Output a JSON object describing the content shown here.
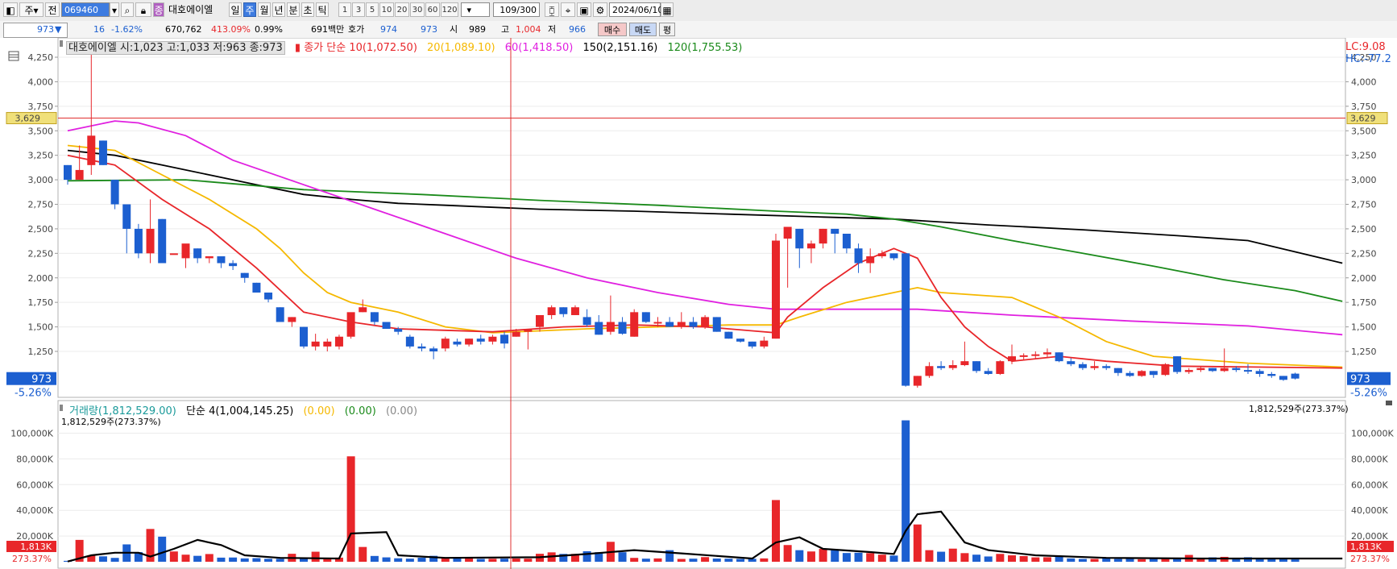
{
  "toolbar": {
    "tab_label": "주",
    "prefix_label": "전",
    "code_value": "069460",
    "search_icon": "search-icon",
    "stock_name": "대호에이엘",
    "periods": [
      "일",
      "주",
      "월",
      "년",
      "분",
      "초",
      "틱"
    ],
    "selected_period": "주",
    "minute_options": [
      "1",
      "3",
      "5",
      "10",
      "20",
      "30",
      "60",
      "120"
    ],
    "count_value": "109/300",
    "date_value": "2024/06/10"
  },
  "quote": {
    "price": "973",
    "change": "16",
    "change_pct": "-1.62%",
    "volume": "670,762",
    "volume_pct": "413.09%",
    "rate": "0.99%",
    "amount": "691백만",
    "bid_label": "호가",
    "bid": "974",
    "ask": "973",
    "open_label": "시",
    "open": "989",
    "high_label": "고",
    "high": "1,004",
    "low_label": "저",
    "low": "966",
    "buy_label": "매수",
    "sell_label": "매도",
    "flat_label": "평"
  },
  "price_legend": {
    "title": "대호에이엘 시:1,023 고:1,033 저:963 종:973",
    "ma_prefix": "종가 단순",
    "ma10": "10(1,072.50)",
    "ma20": "20(1,089.10)",
    "ma60": "60(1,418.50)",
    "ma150": "150(2,151.16)",
    "ma120": "120(1,755.53)",
    "lc": "LC:9.08",
    "hc": "HC:-77.2"
  },
  "price_axis": {
    "ticks": [
      "4,250",
      "4,000",
      "3,750",
      "3,500",
      "3,250",
      "3,000",
      "2,750",
      "2,500",
      "2,250",
      "2,000",
      "1,750",
      "1,500",
      "1,250"
    ],
    "marker_price": "3,629",
    "current_price": "973",
    "current_pct": "-5.26%"
  },
  "volume_legend": {
    "title": "거래량(1,812,529.00)",
    "ma_label": "단순 4(1,004,145.25)",
    "zero1": "(0.00)",
    "zero2": "(0.00)",
    "zero3": "(0.00)",
    "sub_left": "1,812,529주(273.37%)",
    "sub_right": "1,812,529주(273.37%)"
  },
  "volume_axis": {
    "ticks": [
      "100,000K",
      "80,000K",
      "60,000K",
      "40,000K",
      "20,000K"
    ],
    "current": "1,813K",
    "current_pct": "273.37%"
  },
  "colors": {
    "up": "#e8262a",
    "down": "#1c5fd0",
    "ma10": "#e8262a",
    "ma20": "#f5b800",
    "ma60": "#e020e0",
    "ma150": "#000000",
    "ma120": "#1a8a1a",
    "hline": "#e03030",
    "vline": "#e03030"
  },
  "chart_data": {
    "type": "candlestick",
    "period": "weekly",
    "marker_price": 3629,
    "candles": [
      [
        3150,
        3150,
        2950,
        3000
      ],
      [
        3000,
        3350,
        3000,
        3100
      ],
      [
        3150,
        4400,
        3050,
        3450
      ],
      [
        3400,
        3400,
        3150,
        3150
      ],
      [
        3000,
        3000,
        2700,
        2750
      ],
      [
        2750,
        2750,
        2250,
        2500
      ],
      [
        2500,
        2550,
        2200,
        2250
      ],
      [
        2250,
        2800,
        2150,
        2500
      ],
      [
        2600,
        2600,
        2150,
        2150
      ],
      [
        2250,
        2250,
        2250,
        2250
      ],
      [
        2200,
        2320,
        2100,
        2350
      ],
      [
        2300,
        2300,
        2150,
        2200
      ],
      [
        2200,
        2200,
        2150,
        2220
      ],
      [
        2220,
        2220,
        2100,
        2150
      ],
      [
        2150,
        2180,
        2080,
        2120
      ],
      [
        2050,
        2050,
        1950,
        2000
      ],
      [
        1950,
        1950,
        1850,
        1850
      ],
      [
        1850,
        1850,
        1750,
        1780
      ],
      [
        1700,
        1700,
        1550,
        1550
      ],
      [
        1550,
        1600,
        1500,
        1600
      ],
      [
        1500,
        1500,
        1280,
        1300
      ],
      [
        1300,
        1430,
        1260,
        1350
      ],
      [
        1300,
        1380,
        1250,
        1350
      ],
      [
        1300,
        1420,
        1270,
        1400
      ],
      [
        1400,
        1600,
        1380,
        1650
      ],
      [
        1650,
        1780,
        1650,
        1700
      ],
      [
        1650,
        1650,
        1520,
        1550
      ],
      [
        1550,
        1550,
        1480,
        1480
      ],
      [
        1480,
        1500,
        1420,
        1450
      ],
      [
        1400,
        1420,
        1280,
        1300
      ],
      [
        1300,
        1330,
        1250,
        1280
      ],
      [
        1280,
        1300,
        1170,
        1250
      ],
      [
        1280,
        1400,
        1250,
        1380
      ],
      [
        1350,
        1380,
        1300,
        1320
      ],
      [
        1320,
        1380,
        1300,
        1380
      ],
      [
        1380,
        1420,
        1320,
        1350
      ],
      [
        1350,
        1420,
        1320,
        1400
      ],
      [
        1420,
        1450,
        1280,
        1330
      ],
      [
        1400,
        1480,
        1400,
        1450
      ],
      [
        1450,
        1450,
        1270,
        1480
      ],
      [
        1500,
        1530,
        1450,
        1620
      ],
      [
        1620,
        1720,
        1580,
        1700
      ],
      [
        1700,
        1700,
        1600,
        1630
      ],
      [
        1620,
        1720,
        1620,
        1700
      ],
      [
        1600,
        1680,
        1500,
        1520
      ],
      [
        1550,
        1620,
        1420,
        1420
      ],
      [
        1450,
        1820,
        1420,
        1550
      ],
      [
        1550,
        1600,
        1420,
        1430
      ],
      [
        1400,
        1680,
        1400,
        1650
      ],
      [
        1650,
        1650,
        1540,
        1550
      ],
      [
        1550,
        1600,
        1500,
        1550
      ],
      [
        1550,
        1600,
        1500,
        1500
      ],
      [
        1500,
        1650,
        1480,
        1550
      ],
      [
        1550,
        1600,
        1480,
        1500
      ],
      [
        1500,
        1620,
        1480,
        1600
      ],
      [
        1600,
        1600,
        1450,
        1450
      ],
      [
        1450,
        1450,
        1380,
        1380
      ],
      [
        1380,
        1380,
        1340,
        1350
      ],
      [
        1350,
        1350,
        1280,
        1300
      ],
      [
        1300,
        1400,
        1280,
        1360
      ],
      [
        1380,
        2450,
        1380,
        2380
      ],
      [
        2400,
        2520,
        1900,
        2520
      ],
      [
        2500,
        2500,
        2100,
        2300
      ],
      [
        2300,
        2380,
        2150,
        2350
      ],
      [
        2350,
        2500,
        2300,
        2500
      ],
      [
        2500,
        2500,
        2250,
        2450
      ],
      [
        2450,
        2450,
        2250,
        2300
      ],
      [
        2300,
        2350,
        2050,
        2150
      ],
      [
        2150,
        2300,
        2050,
        2220
      ],
      [
        2220,
        2280,
        2200,
        2250
      ],
      [
        2250,
        2250,
        2180,
        2200
      ],
      [
        2250,
        2250,
        890,
        900
      ],
      [
        900,
        1000,
        880,
        1000
      ],
      [
        1000,
        1140,
        980,
        1100
      ],
      [
        1100,
        1150,
        1060,
        1080
      ],
      [
        1080,
        1160,
        1060,
        1110
      ],
      [
        1110,
        1350,
        1100,
        1150
      ],
      [
        1150,
        1150,
        1030,
        1050
      ],
      [
        1050,
        1080,
        1010,
        1020
      ],
      [
        1020,
        1160,
        1010,
        1150
      ],
      [
        1150,
        1320,
        1120,
        1200
      ],
      [
        1200,
        1230,
        1160,
        1210
      ],
      [
        1210,
        1250,
        1180,
        1220
      ],
      [
        1220,
        1280,
        1180,
        1240
      ],
      [
        1240,
        1240,
        1140,
        1150
      ],
      [
        1150,
        1180,
        1100,
        1120
      ],
      [
        1120,
        1140,
        1060,
        1080
      ],
      [
        1080,
        1150,
        1060,
        1100
      ],
      [
        1100,
        1120,
        1060,
        1080
      ],
      [
        1080,
        1080,
        1000,
        1030
      ],
      [
        1030,
        1050,
        990,
        1000
      ],
      [
        1000,
        1060,
        990,
        1050
      ],
      [
        1050,
        1050,
        980,
        1010
      ],
      [
        1010,
        1130,
        1000,
        1120
      ],
      [
        1200,
        1200,
        1020,
        1040
      ],
      [
        1040,
        1080,
        1020,
        1060
      ],
      [
        1060,
        1100,
        1040,
        1080
      ],
      [
        1080,
        1080,
        1040,
        1050
      ],
      [
        1050,
        1280,
        1040,
        1080
      ],
      [
        1080,
        1100,
        1040,
        1060
      ],
      [
        1060,
        1120,
        1020,
        1050
      ],
      [
        1050,
        1070,
        990,
        1020
      ],
      [
        1020,
        1040,
        980,
        1000
      ],
      [
        1000,
        1000,
        950,
        960
      ],
      [
        1023,
        1033,
        963,
        973
      ]
    ],
    "ma10": [
      [
        0,
        3250
      ],
      [
        4,
        3150
      ],
      [
        8,
        2800
      ],
      [
        12,
        2500
      ],
      [
        16,
        2100
      ],
      [
        20,
        1650
      ],
      [
        24,
        1550
      ],
      [
        28,
        1480
      ],
      [
        36,
        1450
      ],
      [
        42,
        1500
      ],
      [
        48,
        1520
      ],
      [
        54,
        1500
      ],
      [
        58,
        1460
      ],
      [
        60,
        1440
      ],
      [
        61,
        1600
      ],
      [
        64,
        1900
      ],
      [
        67,
        2150
      ],
      [
        70,
        2300
      ],
      [
        72,
        2200
      ],
      [
        74,
        1800
      ],
      [
        76,
        1500
      ],
      [
        78,
        1300
      ],
      [
        80,
        1150
      ],
      [
        84,
        1200
      ],
      [
        88,
        1150
      ],
      [
        94,
        1100
      ],
      [
        108,
        1080
      ]
    ],
    "ma20": [
      [
        0,
        3350
      ],
      [
        4,
        3300
      ],
      [
        8,
        3050
      ],
      [
        12,
        2800
      ],
      [
        16,
        2500
      ],
      [
        18,
        2300
      ],
      [
        20,
        2050
      ],
      [
        22,
        1850
      ],
      [
        24,
        1750
      ],
      [
        28,
        1650
      ],
      [
        32,
        1500
      ],
      [
        36,
        1440
      ],
      [
        40,
        1460
      ],
      [
        44,
        1480
      ],
      [
        50,
        1500
      ],
      [
        56,
        1520
      ],
      [
        60,
        1520
      ],
      [
        62,
        1600
      ],
      [
        66,
        1750
      ],
      [
        70,
        1850
      ],
      [
        72,
        1900
      ],
      [
        74,
        1850
      ],
      [
        80,
        1800
      ],
      [
        84,
        1600
      ],
      [
        88,
        1350
      ],
      [
        92,
        1200
      ],
      [
        100,
        1130
      ],
      [
        108,
        1090
      ]
    ],
    "ma60": [
      [
        0,
        3500
      ],
      [
        4,
        3600
      ],
      [
        6,
        3580
      ],
      [
        10,
        3450
      ],
      [
        14,
        3200
      ],
      [
        20,
        2950
      ],
      [
        26,
        2700
      ],
      [
        32,
        2450
      ],
      [
        38,
        2200
      ],
      [
        44,
        2000
      ],
      [
        50,
        1850
      ],
      [
        56,
        1730
      ],
      [
        60,
        1680
      ],
      [
        66,
        1680
      ],
      [
        72,
        1680
      ],
      [
        80,
        1620
      ],
      [
        90,
        1560
      ],
      [
        100,
        1510
      ],
      [
        108,
        1420
      ]
    ],
    "ma150": [
      [
        0,
        3300
      ],
      [
        4,
        3250
      ],
      [
        8,
        3150
      ],
      [
        12,
        3050
      ],
      [
        16,
        2950
      ],
      [
        20,
        2850
      ],
      [
        24,
        2800
      ],
      [
        28,
        2760
      ],
      [
        32,
        2740
      ],
      [
        40,
        2700
      ],
      [
        48,
        2680
      ],
      [
        56,
        2650
      ],
      [
        64,
        2620
      ],
      [
        70,
        2600
      ],
      [
        78,
        2540
      ],
      [
        86,
        2490
      ],
      [
        94,
        2430
      ],
      [
        100,
        2380
      ],
      [
        108,
        2150
      ]
    ],
    "ma120": [
      [
        0,
        2990
      ],
      [
        10,
        3000
      ],
      [
        20,
        2900
      ],
      [
        30,
        2850
      ],
      [
        40,
        2790
      ],
      [
        50,
        2740
      ],
      [
        60,
        2680
      ],
      [
        66,
        2650
      ],
      [
        70,
        2600
      ],
      [
        74,
        2520
      ],
      [
        80,
        2380
      ],
      [
        86,
        2250
      ],
      [
        92,
        2120
      ],
      [
        98,
        1980
      ],
      [
        104,
        1870
      ],
      [
        108,
        1760
      ]
    ],
    "volume": [
      700,
      17000,
      4800,
      4200,
      3000,
      13500,
      7500,
      25500,
      19500,
      8000,
      5500,
      4600,
      6000,
      3200,
      3300,
      2600,
      2800,
      2300,
      2300,
      6200,
      2600,
      7800,
      2700,
      3200,
      82000,
      11500,
      4500,
      3400,
      2700,
      2400,
      3100,
      4600,
      2500,
      2600,
      2500,
      2200,
      2300,
      2400,
      2500,
      2400,
      6200,
      7300,
      6100,
      6100,
      8200,
      7400,
      15500,
      7400,
      3000,
      2400,
      2600,
      9000,
      2200,
      2400,
      3600,
      2500,
      2400,
      2200,
      2300,
      2600,
      48000,
      13000,
      9000,
      8000,
      10000,
      9000,
      6800,
      7000,
      6700,
      5500,
      4800,
      110000,
      29000,
      9000,
      7800,
      10200,
      6700,
      5500,
      4100,
      6100,
      5000,
      4400,
      3400,
      3500,
      4300,
      2600,
      2200,
      2200,
      2600,
      2200,
      2300,
      2000,
      2400,
      2300,
      2300,
      5300,
      2200,
      3400,
      3800,
      2500,
      3500,
      2300,
      2300,
      2700,
      1813
    ],
    "volume_ma4": [
      [
        0,
        200
      ],
      [
        2,
        5000
      ],
      [
        4,
        7000
      ],
      [
        6,
        7000
      ],
      [
        7,
        4000
      ],
      [
        9,
        10000
      ],
      [
        11,
        17000
      ],
      [
        13,
        13000
      ],
      [
        15,
        5000
      ],
      [
        18,
        3000
      ],
      [
        23,
        2500
      ],
      [
        24,
        22000
      ],
      [
        27,
        23000
      ],
      [
        28,
        5000
      ],
      [
        32,
        3000
      ],
      [
        40,
        3500
      ],
      [
        44,
        6000
      ],
      [
        48,
        9000
      ],
      [
        52,
        6500
      ],
      [
        58,
        2500
      ],
      [
        60,
        15000
      ],
      [
        62,
        19000
      ],
      [
        64,
        10000
      ],
      [
        68,
        7500
      ],
      [
        70,
        6000
      ],
      [
        71,
        24000
      ],
      [
        72,
        37000
      ],
      [
        74,
        39000
      ],
      [
        76,
        15000
      ],
      [
        78,
        9000
      ],
      [
        82,
        5000
      ],
      [
        88,
        3000
      ],
      [
        96,
        2500
      ],
      [
        108,
        2500
      ]
    ]
  }
}
